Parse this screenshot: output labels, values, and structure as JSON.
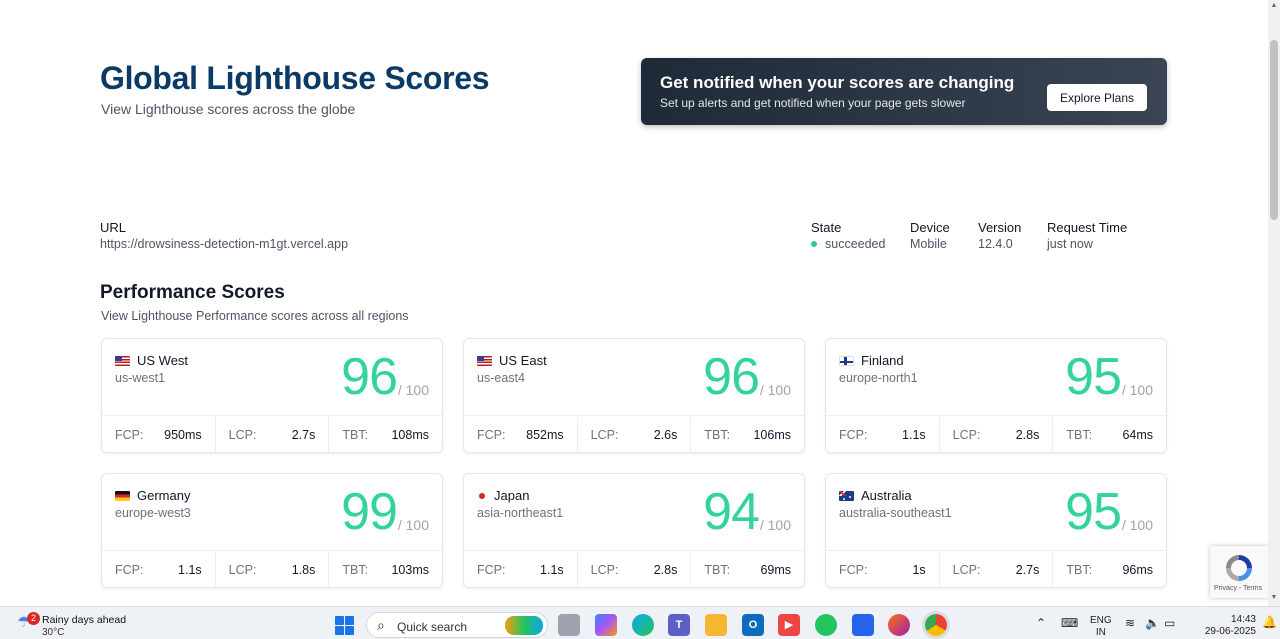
{
  "header": {
    "title": "Global Lighthouse Scores",
    "subtitle": "View Lighthouse scores across the globe"
  },
  "promo": {
    "title": "Get notified when your scores are changing",
    "subtitle": "Set up alerts and get notified when your page gets slower",
    "button_label": "Explore Plans"
  },
  "meta": {
    "url_label": "URL",
    "url_value": "https://drowsiness-detection-m1gt.vercel.app",
    "state_label": "State",
    "state_value": "succeeded",
    "device_label": "Device",
    "device_value": "Mobile",
    "version_label": "Version",
    "version_value": "12.4.0",
    "request_time_label": "Request Time",
    "request_time_value": "just now"
  },
  "section": {
    "title": "Performance Scores",
    "subtitle": "View Lighthouse Performance scores across all regions"
  },
  "score_suffix": "/ 100",
  "metric_labels": {
    "fcp": "FCP:",
    "lcp": "LCP:",
    "tbt": "TBT:"
  },
  "cards": [
    {
      "name": "US West",
      "code": "us-west1",
      "flag": "us",
      "score": "96",
      "fcp": "950ms",
      "lcp": "2.7s",
      "tbt": "108ms"
    },
    {
      "name": "US East",
      "code": "us-east4",
      "flag": "us",
      "score": "96",
      "fcp": "852ms",
      "lcp": "2.6s",
      "tbt": "106ms"
    },
    {
      "name": "Finland",
      "code": "europe-north1",
      "flag": "fi",
      "score": "95",
      "fcp": "1.1s",
      "lcp": "2.8s",
      "tbt": "64ms"
    },
    {
      "name": "Germany",
      "code": "europe-west3",
      "flag": "de",
      "score": "99",
      "fcp": "1.1s",
      "lcp": "1.8s",
      "tbt": "103ms"
    },
    {
      "name": "Japan",
      "code": "asia-northeast1",
      "flag": "jp",
      "score": "94",
      "fcp": "1.1s",
      "lcp": "2.8s",
      "tbt": "69ms"
    },
    {
      "name": "Australia",
      "code": "australia-southeast1",
      "flag": "au",
      "score": "95",
      "fcp": "1s",
      "lcp": "2.7s",
      "tbt": "96ms"
    }
  ],
  "recaptcha": {
    "text": "Privacy - Terms"
  },
  "colors": {
    "accent_title": "#0b3a66",
    "score_green": "#34d399",
    "state_dot": "#34c98e"
  },
  "taskbar": {
    "weather_badge": "2",
    "weather_title": "Rainy days ahead",
    "weather_temp": "30°C",
    "search_placeholder": "Quick search",
    "lang_line1": "ENG",
    "lang_line2": "IN",
    "time": "14:43",
    "date": "29-06-2025"
  }
}
